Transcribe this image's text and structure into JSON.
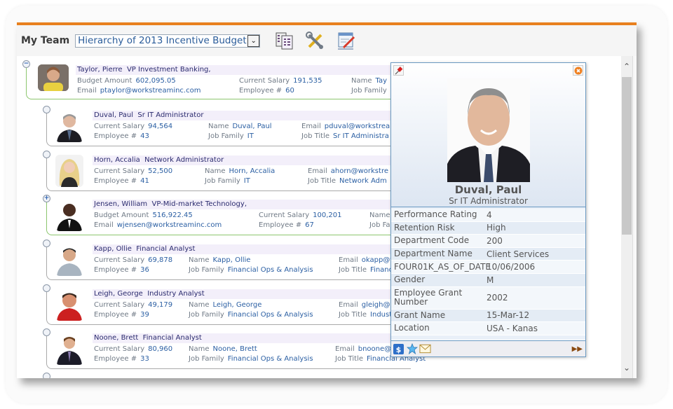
{
  "toolbar": {
    "title": "My Team",
    "view_select": {
      "selected": "Hierarchy of 2013 Incentive Budget"
    },
    "icons": [
      "org-chart-icon",
      "tools-icon",
      "edit-form-icon"
    ]
  },
  "nodes": [
    {
      "name": "Taylor, Pierre",
      "title": "VP Investment Banking,",
      "expand": "−",
      "style": "manager",
      "fields": [
        {
          "label": "Budget Amount",
          "value": "602,095.05"
        },
        {
          "label": "Email",
          "value": "ptaylor@workstreaminc.com"
        },
        {
          "label": "Current Salary",
          "value": "191,535"
        },
        {
          "label": "Employee #",
          "value": "60"
        },
        {
          "label": "Name",
          "value": "Tay"
        },
        {
          "label": "Job Family",
          "value": ""
        }
      ]
    },
    {
      "name": "Duval, Paul",
      "title": "Sr IT Administrator",
      "expand": "",
      "style": "employee",
      "fields": [
        {
          "label": "Current Salary",
          "value": "94,564"
        },
        {
          "label": "Employee #",
          "value": "43"
        },
        {
          "label": "Name",
          "value": "Duval, Paul"
        },
        {
          "label": "Job Family",
          "value": "IT"
        },
        {
          "label": "Email",
          "value": "pduval@workstrea"
        },
        {
          "label": "Job Title",
          "value": "Sr IT Administra"
        }
      ]
    },
    {
      "name": "Horn, Accalia",
      "title": "Network Administrator",
      "expand": "",
      "style": "employee",
      "fields": [
        {
          "label": "Current Salary",
          "value": "52,500"
        },
        {
          "label": "Employee #",
          "value": "41"
        },
        {
          "label": "Name",
          "value": "Horn, Accalia"
        },
        {
          "label": "Job Family",
          "value": "IT"
        },
        {
          "label": "Email",
          "value": "ahorn@workstre"
        },
        {
          "label": "Job Title",
          "value": "Network Adm"
        }
      ]
    },
    {
      "name": "Jensen, William",
      "title": "VP-Mid-market Technology,",
      "expand": "+",
      "style": "manager",
      "fields": [
        {
          "label": "Budget Amount",
          "value": "516,922.45"
        },
        {
          "label": "Email",
          "value": "wjensen@workstreaminc.com"
        },
        {
          "label": "Current Salary",
          "value": "100,201"
        },
        {
          "label": "Employee #",
          "value": "67"
        },
        {
          "label": "Name",
          "value": ""
        },
        {
          "label": "Job Fam",
          "value": ""
        }
      ]
    },
    {
      "name": "Kapp, Ollie",
      "title": "Financial Analyst",
      "expand": "",
      "style": "employee",
      "fields": [
        {
          "label": "Current Salary",
          "value": "69,878"
        },
        {
          "label": "Employee #",
          "value": "36"
        },
        {
          "label": "Name",
          "value": "Kapp, Ollie"
        },
        {
          "label": "Job Family",
          "value": "Financial Ops & Analysis"
        },
        {
          "label": "Email",
          "value": "okapp@v"
        },
        {
          "label": "Job Title",
          "value": "Financ"
        }
      ]
    },
    {
      "name": "Leigh, George",
      "title": "Industry Analyst",
      "expand": "",
      "style": "employee",
      "fields": [
        {
          "label": "Current Salary",
          "value": "49,179"
        },
        {
          "label": "Employee #",
          "value": "39"
        },
        {
          "label": "Name",
          "value": "Leigh, George"
        },
        {
          "label": "Job Family",
          "value": "Financial Ops & Analysis"
        },
        {
          "label": "Email",
          "value": "gleigh@v"
        },
        {
          "label": "Job Title",
          "value": "Indust"
        }
      ]
    },
    {
      "name": "Noone, Brett",
      "title": "Financial Analyst",
      "expand": "",
      "style": "employee",
      "fields": [
        {
          "label": "Current Salary",
          "value": "80,960"
        },
        {
          "label": "Employee #",
          "value": "33"
        },
        {
          "label": "Name",
          "value": "Noone, Brett"
        },
        {
          "label": "Job Family",
          "value": "Financial Ops & Analysis"
        },
        {
          "label": "Email",
          "value": "bnoone@v"
        },
        {
          "label": "Job Title",
          "value": "Financial Analyst"
        }
      ]
    }
  ],
  "popup": {
    "name": "Duval, Paul",
    "title": "Sr IT Administrator",
    "details": [
      {
        "label": "Performance Rating",
        "value": "4"
      },
      {
        "label": "Retention Risk",
        "value": "High"
      },
      {
        "label": "Department Code",
        "value": "200"
      },
      {
        "label": "Department Name",
        "value": "Client Services"
      },
      {
        "label": "FOUR01K_AS_OF_DATE",
        "value": "10/06/2006"
      },
      {
        "label": "Gender",
        "value": "M"
      },
      {
        "label": "Employee Grant Number",
        "value": "2002"
      },
      {
        "label": "Grant Name",
        "value": "15-Mar-12"
      },
      {
        "label": "Location",
        "value": "USA - Kanas"
      }
    ],
    "footer_icons": [
      "dollar-icon",
      "star-icon",
      "mail-icon"
    ],
    "next_label": "▶▶"
  },
  "colors": {
    "accent": "#e8801e",
    "manager_frame": "#8cc66e",
    "employee_frame": "#aaaaaa",
    "link_value": "#2b5fa3",
    "popup_border": "#6b9ac2"
  }
}
